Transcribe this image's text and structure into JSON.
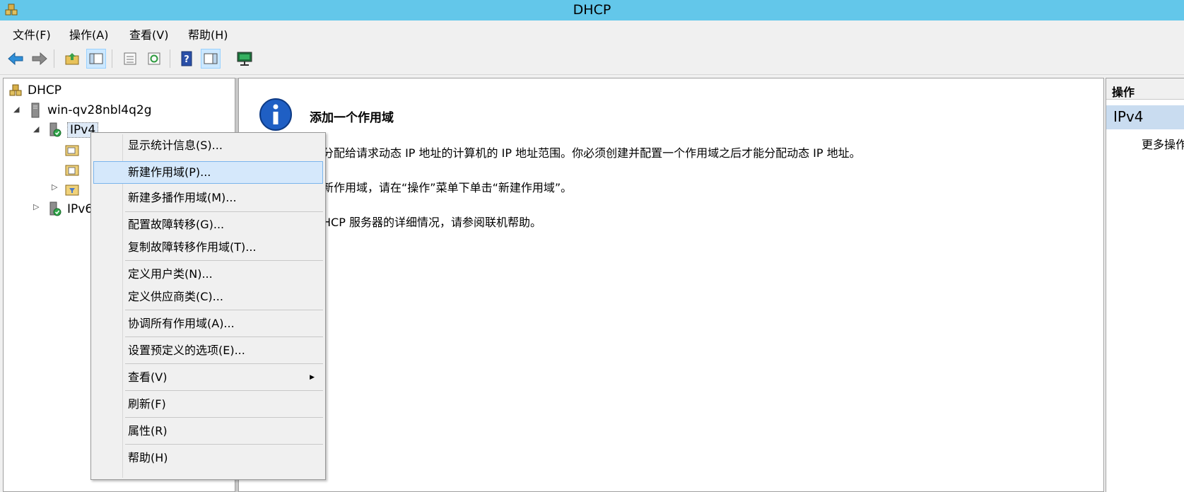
{
  "window": {
    "title": "DHCP"
  },
  "menubar": [
    "文件(F)",
    "操作(A)",
    "查看(V)",
    "帮助(H)"
  ],
  "tree": {
    "root": "DHCP",
    "server": "win-qv28nbl4q2g",
    "ipv4": "IPv4",
    "ipv6": "IPv6"
  },
  "center": {
    "title": "添加一个作用域",
    "line1": "分配给请求动态 IP 地址的计算机的 IP 地址范围。你必须创建并配置一个作用域之后才能分配动态 IP 地址。",
    "line2": "新作用域，请在“操作”菜单下单击“新建作用域”。",
    "line3": "HCP 服务器的详细情况，请参阅联机帮助。"
  },
  "actions": {
    "header": "操作",
    "section": "IPv4",
    "more": "更多操作"
  },
  "context_menu": {
    "items": [
      "显示统计信息(S)...",
      "新建作用域(P)...",
      "新建多播作用域(M)...",
      "配置故障转移(G)...",
      "复制故障转移作用域(T)...",
      "定义用户类(N)...",
      "定义供应商类(C)...",
      "协调所有作用域(A)...",
      "设置预定义的选项(E)...",
      "查看(V)",
      "刷新(F)",
      "属性(R)",
      "帮助(H)"
    ],
    "highlighted_index": 1
  },
  "colors": {
    "titlebar": "#63c7ea",
    "highlight": "#d5e8fb"
  }
}
